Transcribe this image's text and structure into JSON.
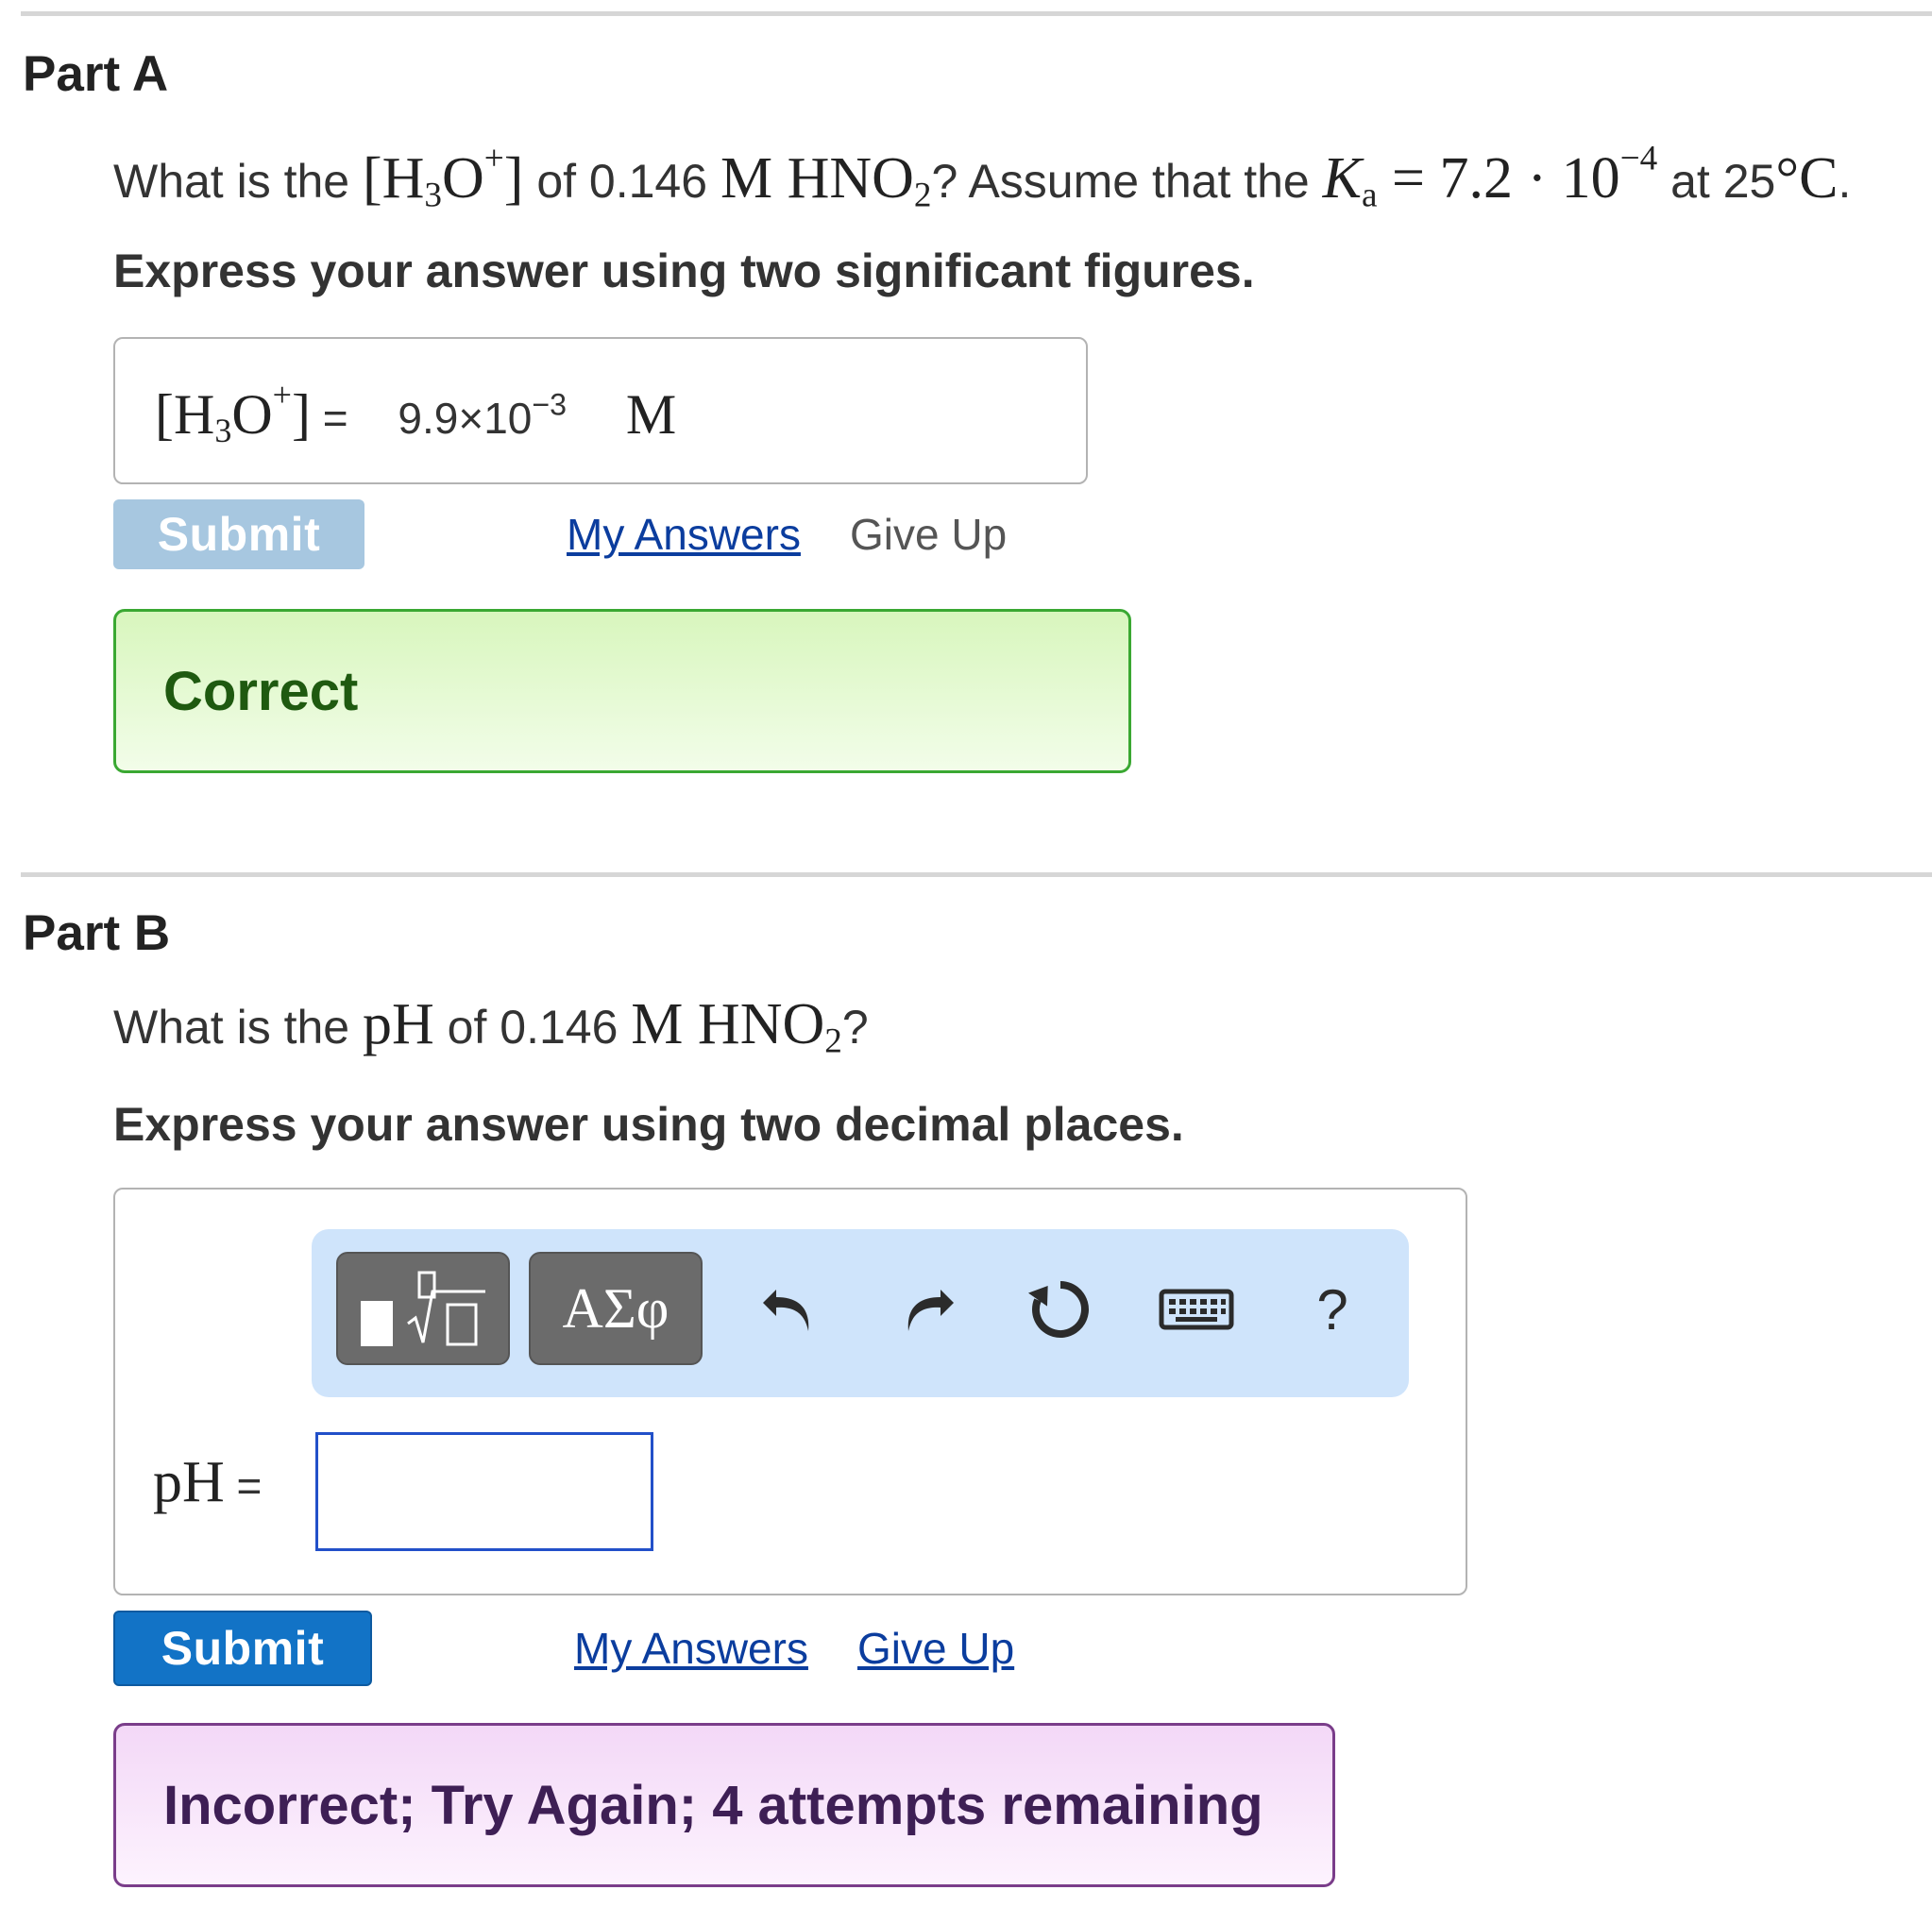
{
  "partA": {
    "title": "Part A",
    "question": {
      "prefix": "What is the ",
      "species_main": "[H",
      "species_sub": "3",
      "species_o": "O",
      "species_sup": "+",
      "species_close": "]",
      "of_text": " of 0.146 ",
      "conc_unit": "M",
      "acid_main": "HNO",
      "acid_sub": "2",
      "assume_text": "? Assume that the ",
      "ka_k": "K",
      "ka_sub": "a",
      "ka_eq": " = 7.2 · 10",
      "ka_exp": "−4",
      "at_text": " at 25",
      "deg": "°",
      "temp_unit": "C",
      "period": "."
    },
    "instruction": "Express your answer using two significant figures.",
    "answer": {
      "label_main": "[H",
      "label_sub": "3",
      "label_o": "O",
      "label_sup": "+",
      "label_close": "]",
      "equals": " =",
      "value_mantissa": "9.9×10",
      "value_exp": "−3",
      "unit": "M"
    },
    "submit_label": "Submit",
    "my_answers_label": "My Answers",
    "give_up_label": "Give Up",
    "feedback": "Correct"
  },
  "partB": {
    "title": "Part B",
    "question": {
      "prefix": "What is the ",
      "ph": "pH",
      "of_text": " of 0.146 ",
      "conc_unit": "M",
      "acid_main": "HNO",
      "acid_sub": "2",
      "qmark": "?"
    },
    "instruction": "Express your answer using two decimal places.",
    "toolbar": {
      "greek_label": "ΑΣφ",
      "help_label": "?"
    },
    "answer": {
      "label": "pH",
      "equals": " =",
      "input_value": ""
    },
    "submit_label": "Submit",
    "my_answers_label": "My Answers",
    "give_up_label": "Give Up",
    "feedback": "Incorrect; Try Again; 4 attempts remaining"
  },
  "colors": {
    "submit_disabled": "#a7c7e0",
    "submit_active": "#1273c6",
    "correct_bg": "#e3f8cf",
    "correct_border": "#3aa832",
    "correct_text": "#1f5a10",
    "incorrect_bg": "#f6def8",
    "incorrect_border": "#7a3d8a",
    "incorrect_text": "#3e1f55",
    "toolbar_bg": "#cfe4fb"
  }
}
